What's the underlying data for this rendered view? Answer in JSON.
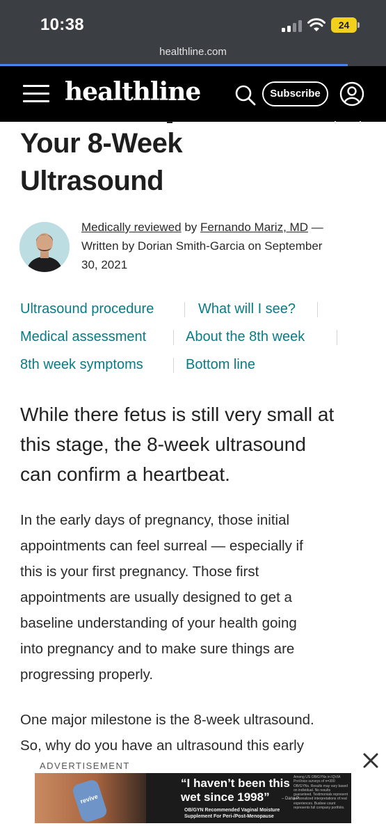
{
  "status_bar": {
    "time": "10:38",
    "battery_level": "24"
  },
  "browser": {
    "url": "healthline.com",
    "load_progress": 0.9
  },
  "header": {
    "logo": "healthline",
    "subscribe_label": "Subscribe"
  },
  "article": {
    "title_lines": [
      "Your 8-Week",
      "Ultrasound"
    ],
    "byline": {
      "reviewed_label": "Medically reviewed",
      "by_1": " by ",
      "reviewer": "Fernando Mariz, MD",
      "dash": " —",
      "written_line_1": "Written by Dorian Smith-Garcia on September",
      "written_line_2": "30, 2021"
    },
    "toc": [
      "Ultrasound procedure",
      "What will I see?",
      "Medical assessment",
      "About the 8th week",
      "8th week symptoms",
      "Bottom line"
    ],
    "lede_lines": [
      "While there fetus is still very small at",
      "this stage, the 8-week ultrasound",
      "can confirm a heartbeat."
    ],
    "para1_lines": [
      "In the early days of pregnancy, those initial",
      "appointments can feel surreal — especially if",
      "this is your first pregnancy. Those first",
      "appointments are usually designed to get a",
      "baseline understanding of your health going",
      "into pregnancy and to make sure things are",
      "progressing properly."
    ],
    "para2_lines": [
      "One major milestone is the 8-week ultrasound.",
      "So, why do you have an ultrasound this early"
    ]
  },
  "ad": {
    "label": "ADVERTISEMENT",
    "headline_line_1": "“I haven’t been this",
    "headline_line_2": "wet since 1998”",
    "attribution": "– Dana P.",
    "sub_line_1": "OB/GYN Recommended Vaginal Moisture",
    "sub_line_2": "Supplement For Peri-/Post-Menopause",
    "bottle_label": "revive",
    "fine_print": "Among US OB/GYNs in IQVIA ProVoice surveys of n=300 OB/GYNs. Results may vary based on individual. No results guaranteed. Testimonials represent personalized interpretations of real experiences. Busbee count represents full company portfolio."
  },
  "colors": {
    "accent_teal": "#077c84",
    "header_bg": "#000000",
    "battery_yellow": "#f2d11d"
  },
  "icons": [
    "signal-icon",
    "wifi-icon",
    "menu-icon",
    "search-icon",
    "account-icon",
    "close-icon"
  ]
}
